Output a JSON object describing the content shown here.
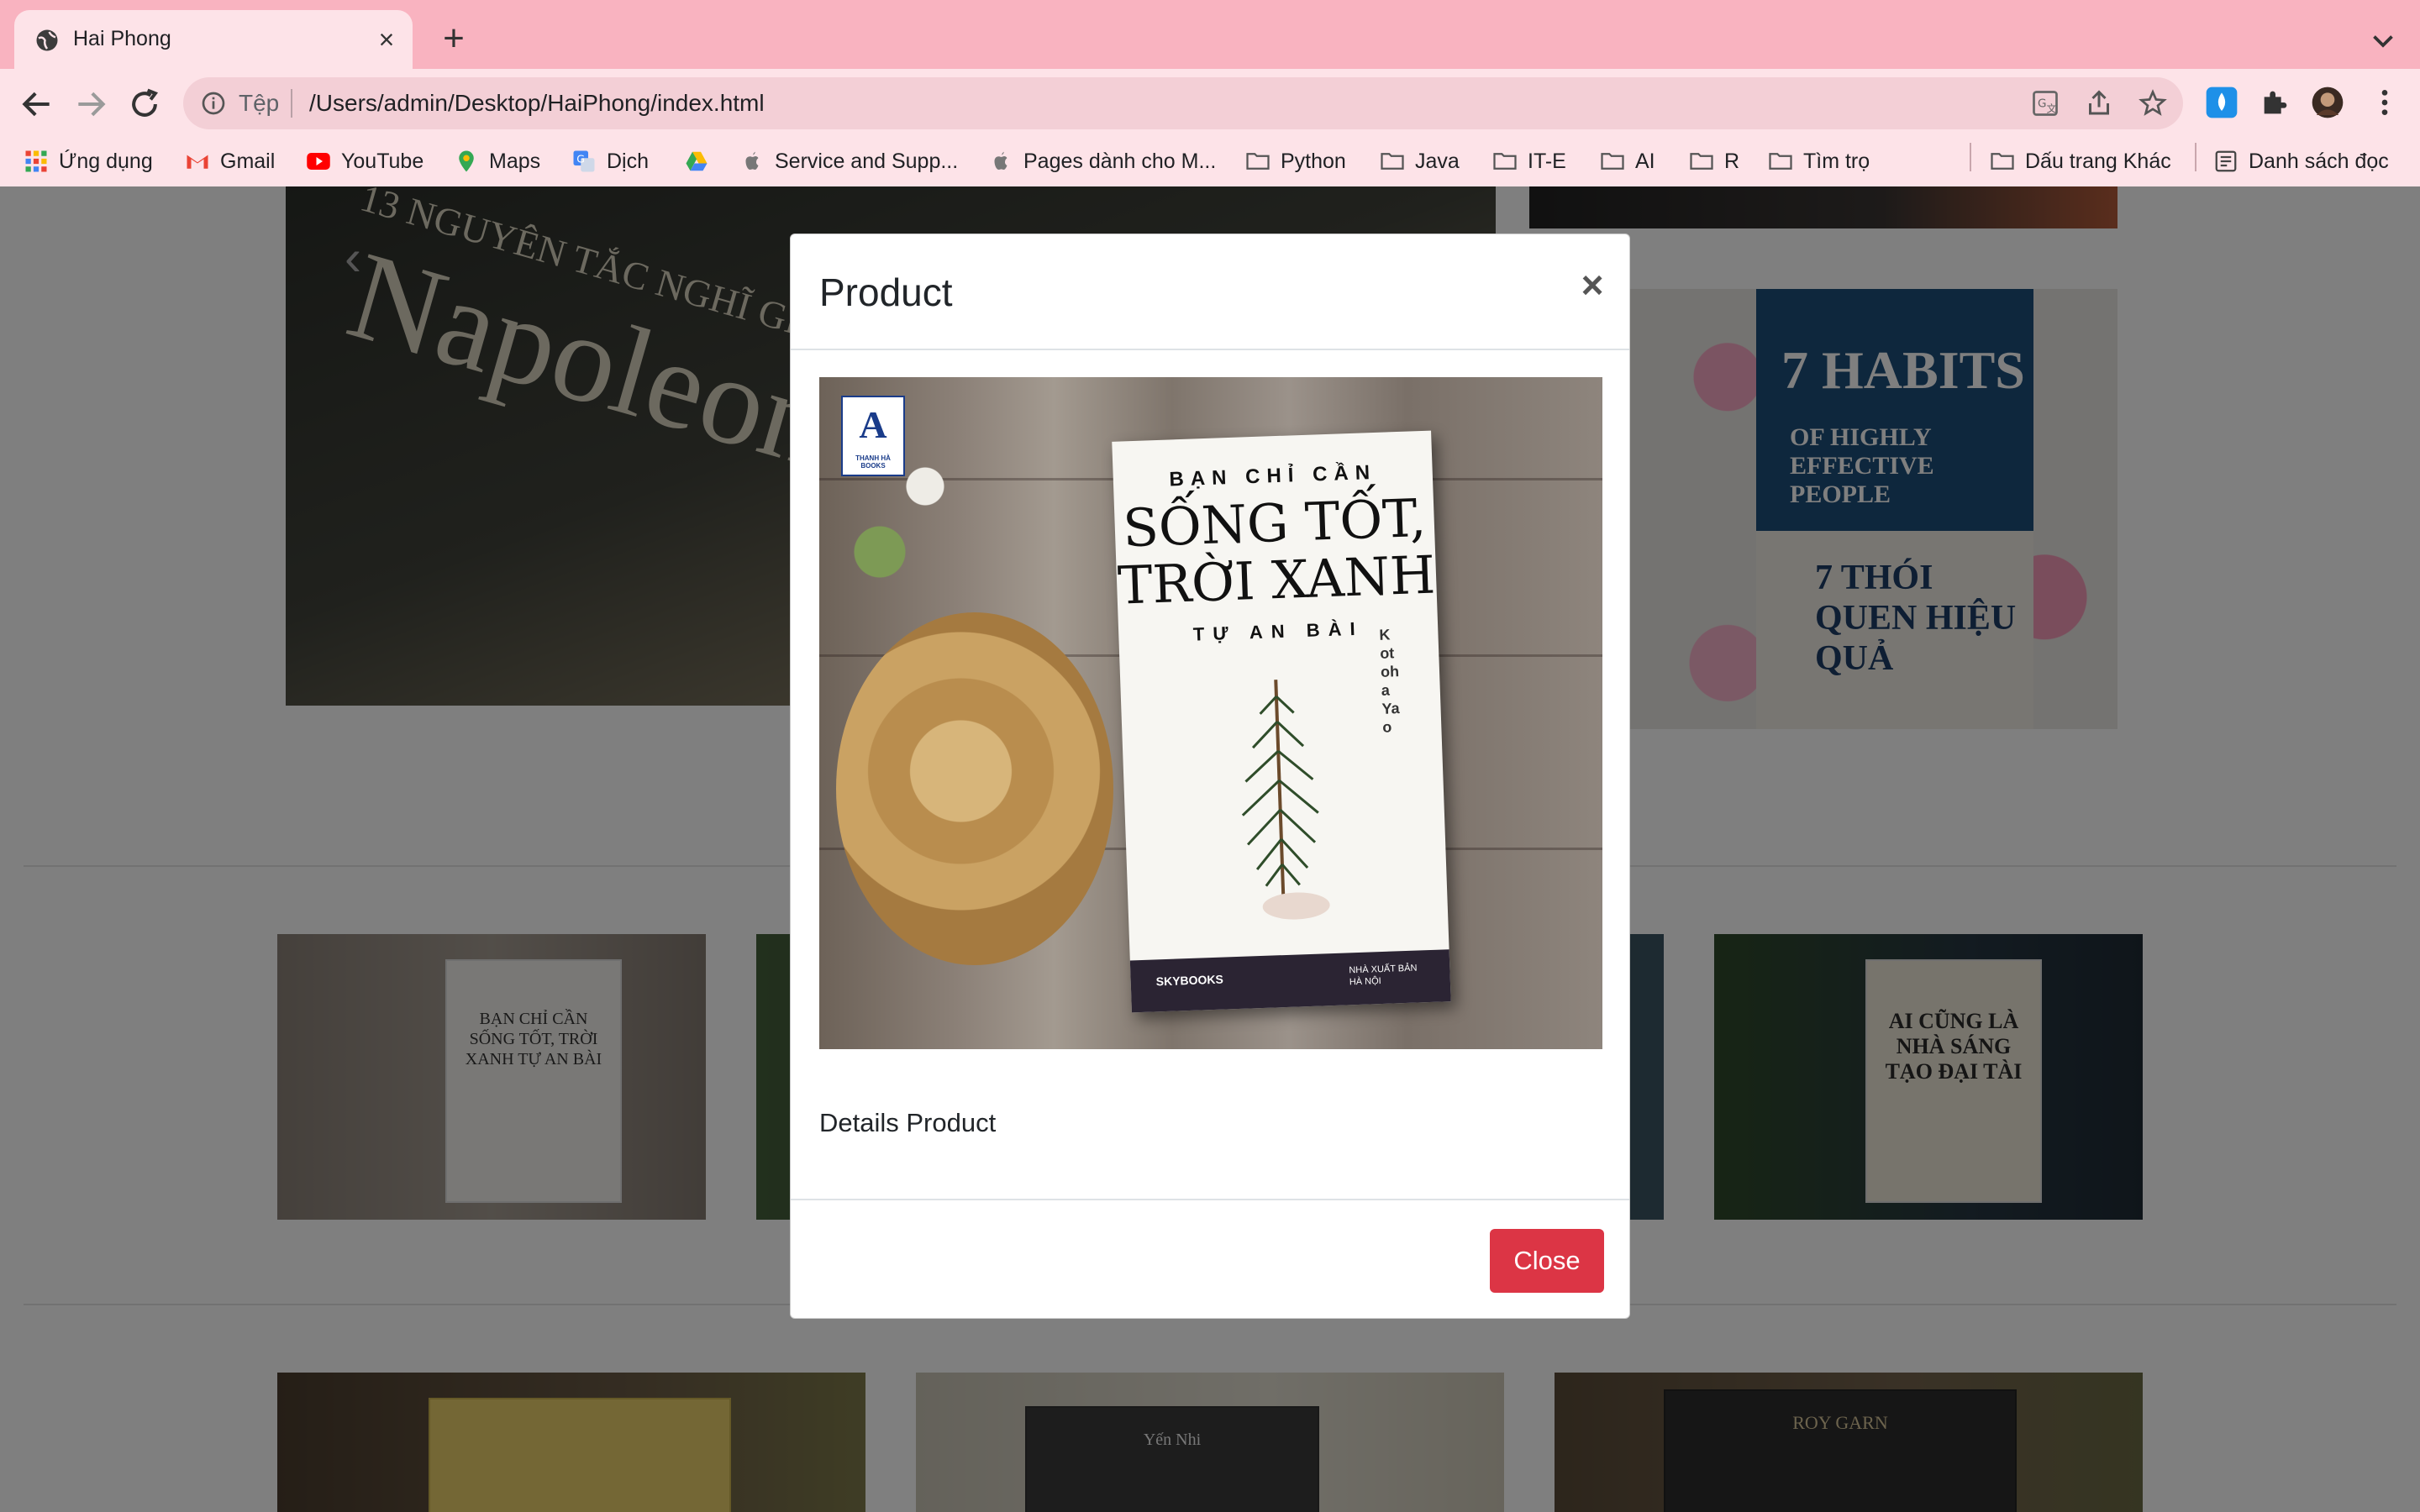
{
  "browser": {
    "tab_title": "Hai Phong",
    "address_scheme": "Tệp",
    "address_url": "/Users/admin/Desktop/HaiPhong/index.html"
  },
  "bookmarks": [
    {
      "label": "Ứng dụng",
      "icon": "apps-grid-icon"
    },
    {
      "label": "Gmail",
      "icon": "gmail-icon"
    },
    {
      "label": "YouTube",
      "icon": "youtube-icon"
    },
    {
      "label": "Maps",
      "icon": "maps-icon"
    },
    {
      "label": "Dịch",
      "icon": "translate-icon"
    },
    {
      "label": "",
      "icon": "drive-icon"
    },
    {
      "label": "Service and Supp...",
      "icon": "apple-icon"
    },
    {
      "label": "Pages dành cho M...",
      "icon": "apple-icon"
    },
    {
      "label": "Python",
      "icon": "folder-icon"
    },
    {
      "label": "Java",
      "icon": "folder-icon"
    },
    {
      "label": "IT-E",
      "icon": "folder-icon"
    },
    {
      "label": "AI",
      "icon": "folder-icon"
    },
    {
      "label": "R",
      "icon": "folder-icon"
    },
    {
      "label": "Tìm trọ",
      "icon": "folder-icon"
    },
    {
      "label": "Dấu trang Khác",
      "icon": "folder-icon"
    },
    {
      "label": "Danh sách đọc",
      "icon": "reading-list-icon"
    }
  ],
  "page": {
    "hero_left": {
      "subtitle": "13 NGUYÊN TẮC NGHĨ GI",
      "title": "Napoleon"
    },
    "hero_right": {
      "line1": "7 HABITS",
      "line2": "OF HIGHLY EFFECTIVE PEOPLE",
      "line3": "7 THÓI QUEN HIỆU QUẢ"
    },
    "cards_row1": [
      {
        "title": "BẠN CHỈ CẦN SỐNG TỐT, TRỜI XANH TỰ AN BÀI"
      },
      {
        "title": ""
      },
      {
        "title": "AI CŨNG LÀ NHÀ SÁNG TẠO ĐẠI TÀI"
      }
    ],
    "cards_row2": [
      {
        "title": ""
      },
      {
        "title": "Yến Nhi"
      },
      {
        "title": "ROY GARN"
      }
    ]
  },
  "modal": {
    "title": "Product",
    "close_x": "×",
    "body_text": "Details Product",
    "close_button": "Close",
    "image": {
      "publisher_logo_text": "THANH HÀ BOOKS",
      "cover_line1": "BẠN CHỈ CẦN",
      "cover_line2": "SỐNG TỐT, TRỜI XANH",
      "cover_line3": "TỰ AN BÀI",
      "cover_author": "Kotoha Yao",
      "cover_brand": "SKYBOOKS",
      "cover_publisher": "NHÀ XUẤT BẢN HÀ NỘI"
    }
  },
  "colors": {
    "tabbar": "#f9b3c0",
    "toolbar": "#fde3e8",
    "close_button": "#dc3545"
  }
}
